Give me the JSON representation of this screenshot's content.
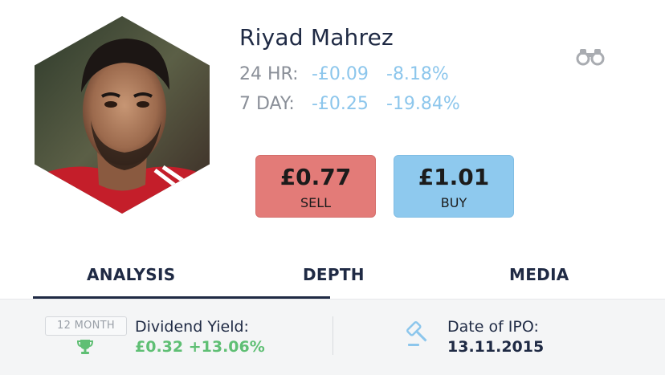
{
  "player": {
    "name": "Riyad Mahrez",
    "stats": {
      "h24": {
        "label": "24 HR:",
        "change": "-£0.09",
        "percent": "-8.18%"
      },
      "d7": {
        "label": "7 DAY:",
        "change": "-£0.25",
        "percent": "-19.84%"
      }
    }
  },
  "trade": {
    "sell": {
      "price": "£0.77",
      "label": "SELL",
      "color": "#e37b78"
    },
    "buy": {
      "price": "£1.01",
      "label": "BUY",
      "color": "#8ec9ee"
    }
  },
  "tabs": [
    {
      "label": "ANALYSIS",
      "active": true
    },
    {
      "label": "DEPTH",
      "active": false
    },
    {
      "label": "MEDIA",
      "active": false
    }
  ],
  "footer": {
    "period_badge": "12 MONTH",
    "dividend_label": "Dividend Yield:",
    "dividend_value": "£0.32 +13.06%",
    "ipo_label": "Date of IPO:",
    "ipo_value": "13.11.2015"
  },
  "icons": {
    "watchlist": "binoculars-icon",
    "dividend": "trophy-icon",
    "ipo": "gavel-icon"
  },
  "colors": {
    "positive": "#5fbf74",
    "change": "#8cc6ec",
    "text": "#1f2a44"
  }
}
